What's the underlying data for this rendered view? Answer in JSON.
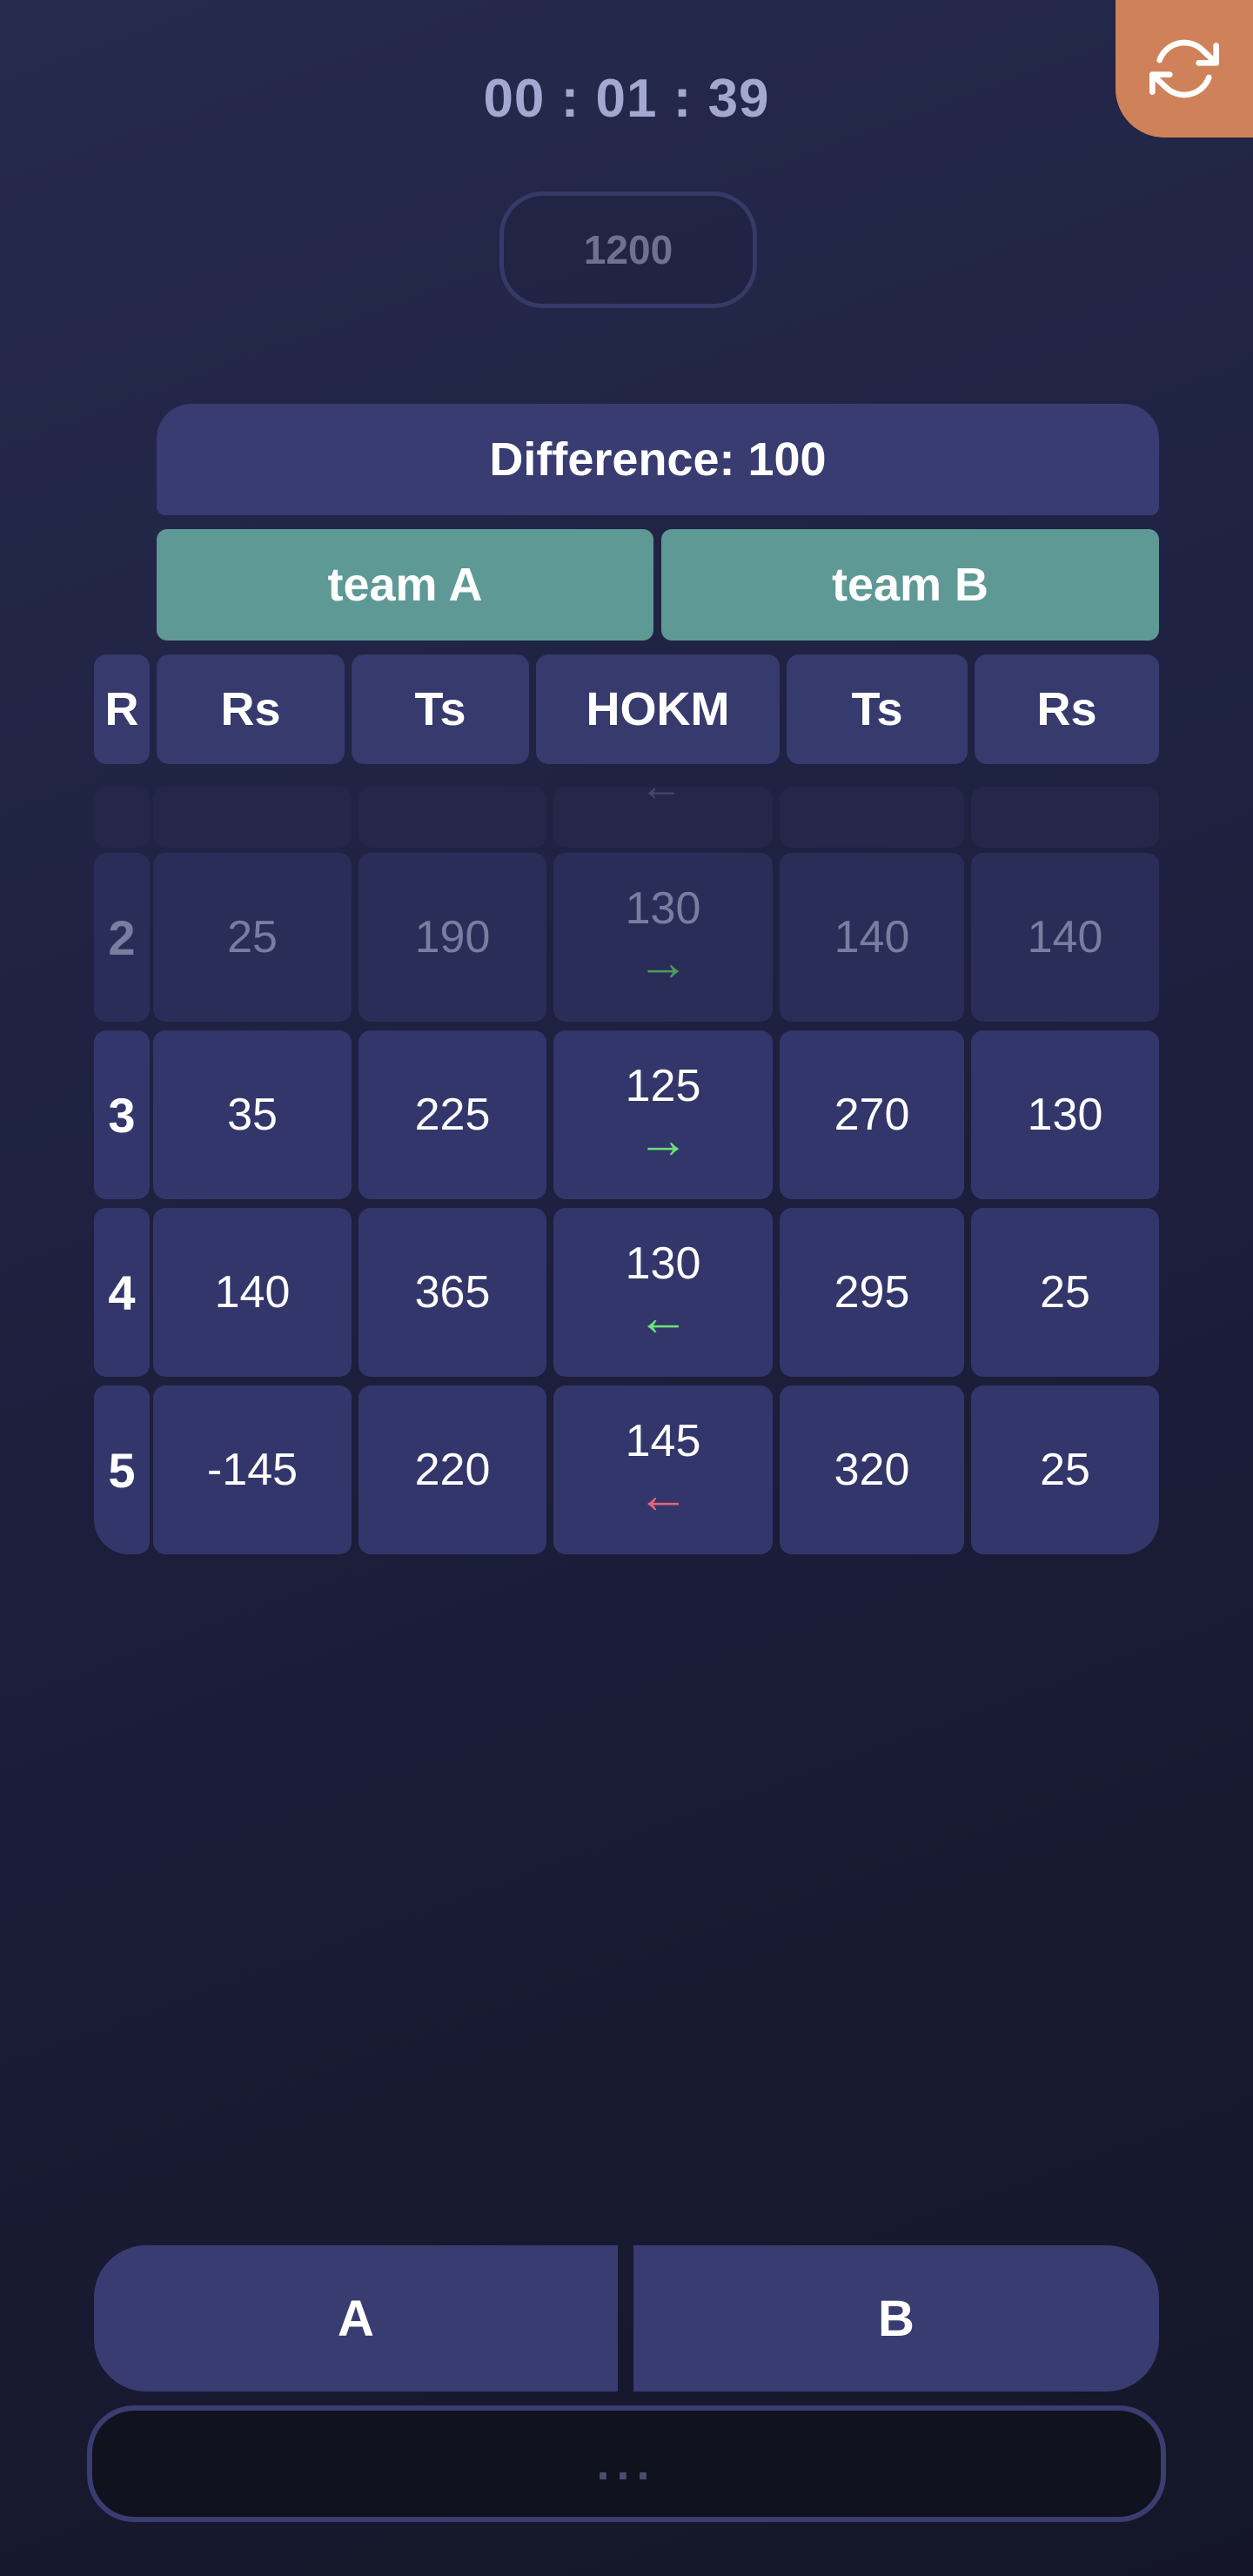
{
  "timer": "00 : 01 : 39",
  "target": "1200",
  "difference": "Difference: 100",
  "teams": {
    "a": "team A",
    "b": "team B"
  },
  "headers": [
    "R",
    "Rs",
    "Ts",
    "HOKM",
    "Ts",
    "Rs"
  ],
  "rows": [
    {
      "round": "2",
      "a_rs": "25",
      "a_ts": "190",
      "hokm": "130",
      "arrow": "→",
      "arrow_color": "green",
      "b_ts": "140",
      "b_rs": "140"
    },
    {
      "round": "3",
      "a_rs": "35",
      "a_ts": "225",
      "hokm": "125",
      "arrow": "→",
      "arrow_color": "green",
      "b_ts": "270",
      "b_rs": "130"
    },
    {
      "round": "4",
      "a_rs": "140",
      "a_ts": "365",
      "hokm": "130",
      "arrow": "←",
      "arrow_color": "green",
      "b_ts": "295",
      "b_rs": "25"
    },
    {
      "round": "5",
      "a_rs": "-145",
      "a_ts": "220",
      "hokm": "145",
      "arrow": "←",
      "arrow_color": "red",
      "b_ts": "320",
      "b_rs": "25"
    }
  ],
  "partial_row_arrow": "←",
  "choices": {
    "a": "A",
    "b": "B"
  },
  "submit_placeholder": "...",
  "colors": {
    "accent": "#cf8259",
    "team": "#5e9995",
    "panel": "#393c70",
    "arrow_green": "#6ee07a",
    "arrow_red": "#e86479"
  },
  "icons": {
    "refresh": "refresh-icon"
  }
}
